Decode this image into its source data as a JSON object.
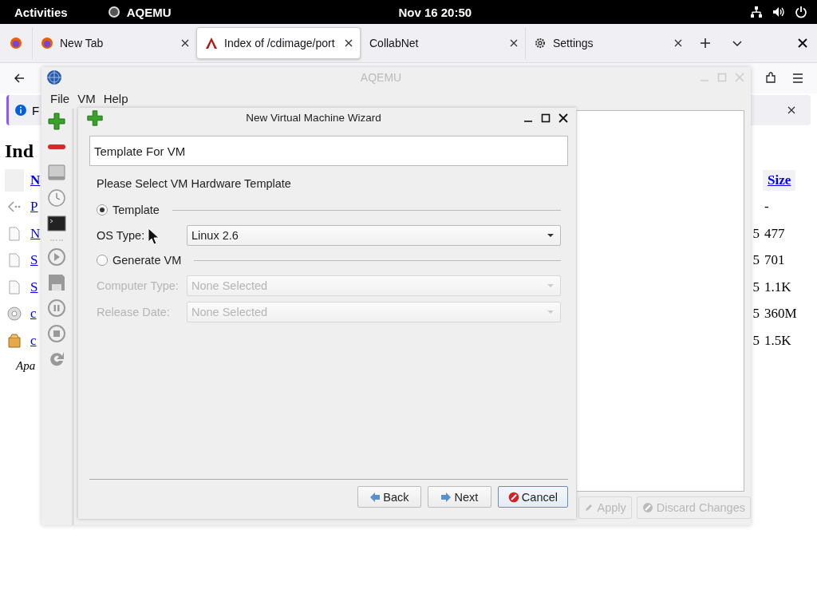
{
  "top_bar": {
    "activities": "Activities",
    "app": "AQEMU",
    "clock": "Nov 16  20:50"
  },
  "browser": {
    "tabs": [
      {
        "label": "New Tab",
        "selected": false,
        "kind": "firefox"
      },
      {
        "label": "Index of /cdimage/port",
        "selected": true,
        "kind": "arch"
      },
      {
        "label": "CollabNet",
        "selected": false,
        "kind": "plain"
      },
      {
        "label": "Settings",
        "selected": false,
        "kind": "settings"
      }
    ],
    "notification": "F",
    "page": {
      "heading": "Ind",
      "size_header": "Size",
      "footer": "Apa",
      "rows": [
        {
          "kind": "header",
          "link": "N",
          "date": "",
          "size": ""
        },
        {
          "kind": "parent",
          "link": "P",
          "date": "",
          "size": "-"
        },
        {
          "kind": "file",
          "link": "N",
          "date": "5",
          "size": "477"
        },
        {
          "kind": "file",
          "link": "S",
          "date": "5",
          "size": "701"
        },
        {
          "kind": "file",
          "link": "S",
          "date": "5",
          "size": "1.1K"
        },
        {
          "kind": "disc",
          "link": "c",
          "date": "5",
          "size": "360M"
        },
        {
          "kind": "package",
          "link": "c",
          "date": "5",
          "size": "1.5K"
        }
      ]
    }
  },
  "aqemu": {
    "title": "AQEMU",
    "menu": [
      "File",
      "VM",
      "Help"
    ],
    "actions": [
      {
        "label": "Apply",
        "kind": "apply",
        "disabled": true
      },
      {
        "label": "Discard Changes",
        "kind": "discard",
        "disabled": true
      }
    ]
  },
  "wizard": {
    "title": "New Virtual Machine Wizard",
    "header": "Template For VM",
    "prompt": "Please Select VM Hardware Template",
    "options": [
      {
        "label": "Template",
        "selected": true,
        "fields": [
          {
            "label": "OS Type:",
            "value": "Linux 2.6",
            "disabled": false
          }
        ]
      },
      {
        "label": "Generate VM",
        "selected": false,
        "fields": [
          {
            "label": "Computer Type:",
            "value": "None Selected",
            "disabled": true
          },
          {
            "label": "Release Date:",
            "value": "None Selected",
            "disabled": true
          }
        ]
      }
    ],
    "buttons": [
      {
        "label": "Back",
        "kind": "back",
        "focused": false
      },
      {
        "label": "Next",
        "kind": "next",
        "focused": false
      },
      {
        "label": "Cancel",
        "kind": "cancel",
        "focused": true
      }
    ]
  }
}
